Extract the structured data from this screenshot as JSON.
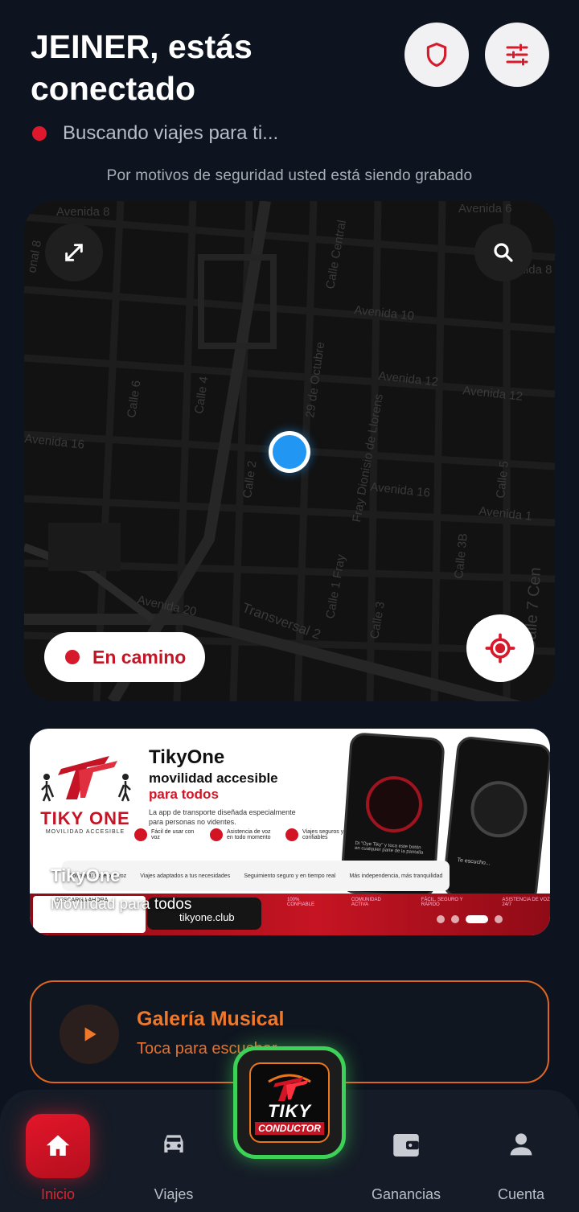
{
  "header": {
    "title": "JEINER, estás conectado",
    "shield_icon": "shield-icon",
    "settings_icon": "sliders-icon"
  },
  "status": {
    "text": "Buscando viajes para ti..."
  },
  "notice": "Por motivos de seguridad usted está siendo grabado",
  "map": {
    "street_labels": [
      "Avenida 8",
      "Avenida 6",
      "Avenida 10",
      "Avenida 12",
      "Avenida 12",
      "Avenida 16",
      "Avenida 16",
      "Avenida 20",
      "Avenida 8",
      "Calle Central",
      "Calle 4",
      "Calle 6",
      "Calle 2",
      "29 de Octubre",
      "Fray Dionisio de Llorens",
      "Calle 1 Fray",
      "Calle 3",
      "Calle 5",
      "Calle 3B",
      "Calle 7 Cen",
      "Transversal 2",
      "Avenida 1",
      "onal 8"
    ],
    "status_chip": "En camino"
  },
  "banner": {
    "brand": "TikyOne",
    "headline1": "movilidad accesible",
    "headline2": "para todos",
    "desc": "La app de transporte diseñada especialmente para personas no videntes.",
    "logo_text": "TIKY ONE",
    "logo_sub": "MOVILIDAD ACCESIBLE",
    "features": [
      "Fácil de usar con voz",
      "Asistencia de voz en todo momento",
      "Viajes seguros y confiables"
    ],
    "strip": [
      "Solicita tu viaje por voz",
      "Viajes adaptados a tus necesidades",
      "Seguimiento seguro y en tiempo real",
      "Más independencia, más tranquilidad"
    ],
    "download": "DESCARGA AHORA",
    "url": "tikyone.club",
    "stats": [
      "100% CONFIABLE",
      "COMUNIDAD ACTIVA",
      "FÁCIL, SEGURO Y RÁPIDO",
      "ASISTENCIA DE VOZ 24/7"
    ],
    "overlay_title": "TikyOne",
    "overlay_subtitle": "Movilidad para todos",
    "phone_text": "Di \"Oye Tiky\" y toca este botón en cualquier parte de la pantalla",
    "phone2_text": "Te escucho..."
  },
  "music": {
    "title": "Galería Musical",
    "subtitle": "Toca para escuchar"
  },
  "nav": {
    "items": [
      {
        "label": "Inicio",
        "icon": "home-icon",
        "active": true
      },
      {
        "label": "Viajes",
        "icon": "car-icon",
        "active": false
      },
      {
        "label": "Ganancias",
        "icon": "wallet-icon",
        "active": false
      },
      {
        "label": "Cuenta",
        "icon": "person-icon",
        "active": false
      }
    ],
    "center_logo_text": "TIKY",
    "center_logo_sub": "CONDUCTOR"
  },
  "colors": {
    "background": "#0d141f",
    "accent_red": "#e0182d",
    "music_orange": "#f0782b",
    "center_green": "#3ed158",
    "location_blue": "#2196f3"
  }
}
